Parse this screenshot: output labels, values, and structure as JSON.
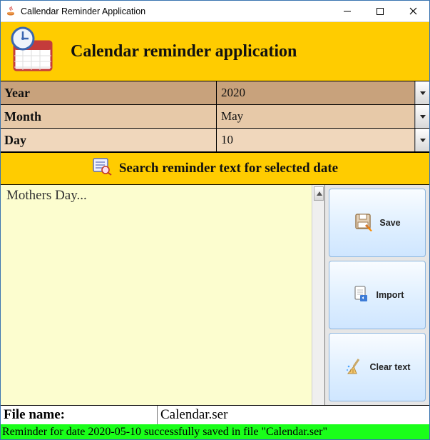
{
  "window": {
    "title": "Callendar Reminder Application"
  },
  "header": {
    "title": "Calendar reminder application"
  },
  "fields": {
    "year": {
      "label": "Year",
      "value": "2020"
    },
    "month": {
      "label": "Month",
      "value": "May"
    },
    "day": {
      "label": "Day",
      "value": "10"
    }
  },
  "search": {
    "label": "Search reminder text for selected date"
  },
  "editor": {
    "text": "Mothers Day..."
  },
  "buttons": {
    "save": {
      "label": "Save"
    },
    "import": {
      "label": "Import"
    },
    "clear": {
      "label": "Clear text"
    }
  },
  "file": {
    "label": "File name:",
    "value": "Calendar.ser"
  },
  "status": {
    "text": "Reminder for date 2020-05-10 successfully saved in file \"Calendar.ser\""
  }
}
